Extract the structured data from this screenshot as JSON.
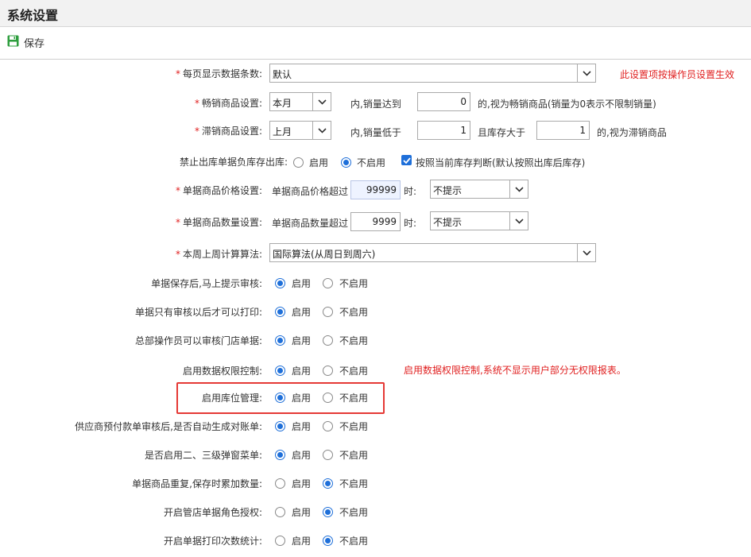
{
  "window": {
    "title": "系统设置"
  },
  "toolbar": {
    "save_label": "保存"
  },
  "required_mark": "*",
  "rows": {
    "page_size": {
      "label": "每页显示数据条数:",
      "select_value": "默认",
      "note": "此设置项按操作员设置生效"
    },
    "hot_goods": {
      "label": "畅销商品设置:",
      "period": "本月",
      "text1": "内,销量达到",
      "amount": "0",
      "text2": "的,视为畅销商品(销量为0表示不限制销量)"
    },
    "slow_goods": {
      "label": "滞销商品设置:",
      "period": "上月",
      "text1": "内,销量低于",
      "amount": "1",
      "text2": "且库存大于",
      "stock": "1",
      "text3": "的,视为滞销商品"
    },
    "negative_stock": {
      "label": "禁止出库单据负库存出库:",
      "opt_on": "启用",
      "opt_off": "不启用",
      "selected": "off",
      "checkbox_checked": true,
      "checkbox_label": "按照当前库存判断(默认按照出库后库存)"
    },
    "price_check": {
      "label": "单据商品价格设置:",
      "text1": "单据商品价格超过",
      "amount": "99999",
      "text2": "时:",
      "select_value": "不提示"
    },
    "qty_check": {
      "label": "单据商品数量设置:",
      "text1": "单据商品数量超过",
      "amount": "9999",
      "text2": "时:",
      "select_value": "不提示"
    },
    "week_calc": {
      "label": "本周上周计算算法:",
      "select_value": "国际算法(从周日到周六)"
    },
    "audit_after_save": {
      "label": "单据保存后,马上提示审核:",
      "opt_on": "启用",
      "opt_off": "不启用",
      "selected": "on"
    },
    "print_after_audit": {
      "label": "单据只有审核以后才可以打印:",
      "opt_on": "启用",
      "opt_off": "不启用",
      "selected": "on"
    },
    "hq_audit_store": {
      "label": "总部操作员可以审核门店单据:",
      "opt_on": "启用",
      "opt_off": "不启用",
      "selected": "on"
    },
    "data_permission": {
      "label": "启用数据权限控制:",
      "opt_on": "启用",
      "opt_off": "不启用",
      "selected": "on",
      "note": "启用数据权限控制,系统不显示用户部分无权限报表。"
    },
    "location_mgmt": {
      "label": "启用库位管理:",
      "opt_on": "启用",
      "opt_off": "不启用",
      "selected": "on"
    },
    "supplier_prepay": {
      "label": "供应商预付款单审核后,是否自动生成对账单:",
      "opt_on": "启用",
      "opt_off": "不启用",
      "selected": "on"
    },
    "popup_menu": {
      "label": "是否启用二、三级弹窗菜单:",
      "opt_on": "启用",
      "opt_off": "不启用",
      "selected": "on"
    },
    "duplicate_goods": {
      "label": "单据商品重复,保存时累加数量:",
      "opt_on": "启用",
      "opt_off": "不启用",
      "selected": "off"
    },
    "store_role_auth": {
      "label": "开启管店单据角色授权:",
      "opt_on": "启用",
      "opt_off": "不启用",
      "selected": "off"
    },
    "print_count": {
      "label": "开启单据打印次数统计:",
      "opt_on": "启用",
      "opt_off": "不启用",
      "selected": "off"
    }
  },
  "colors": {
    "accent": "#1e6fd9",
    "required": "#e02020",
    "highlight_border": "#e53935",
    "save_icon": "#2e9e3e"
  }
}
